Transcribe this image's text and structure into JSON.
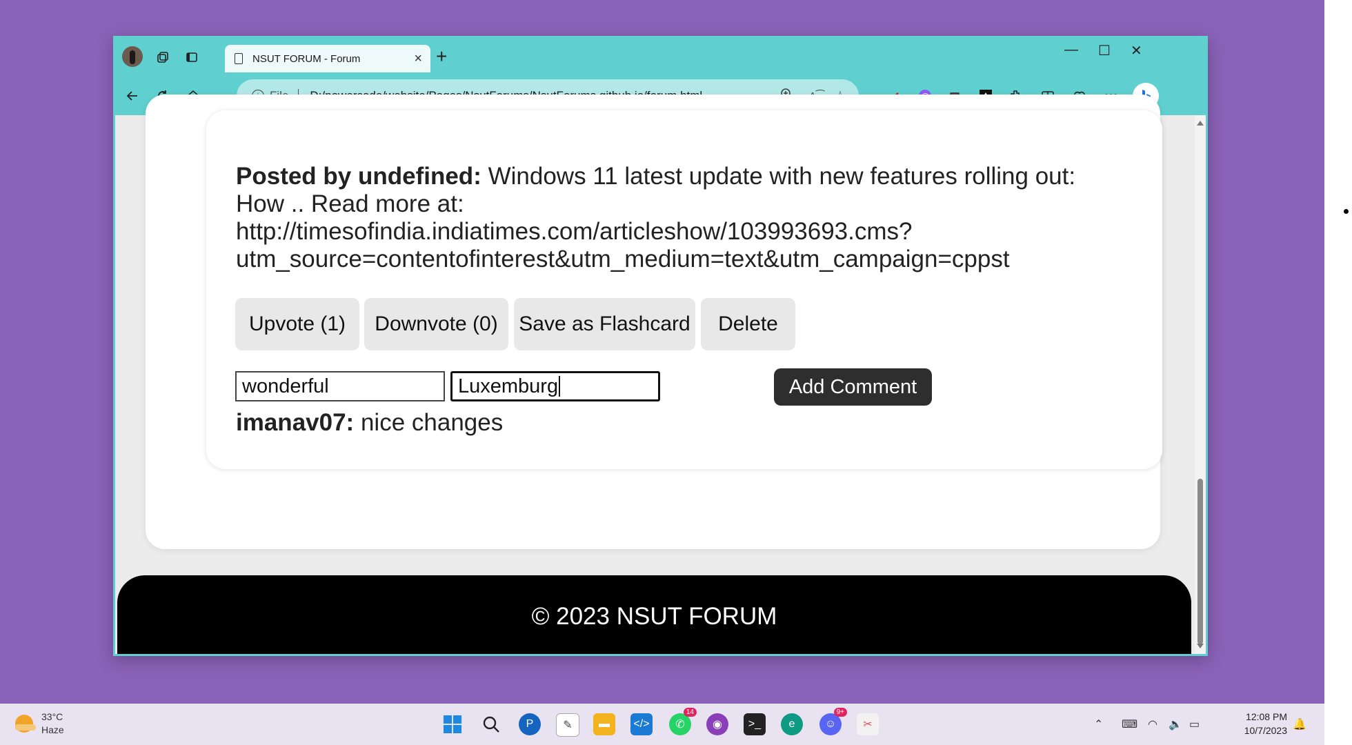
{
  "browser": {
    "tab_title": "NSUT FORUM - Forum",
    "new_tab_symbol": "+",
    "address_label": "File",
    "url": "D:/powercode/website/Pages/NsutForums/NsutForums.github.io/forum.html",
    "window_controls": {
      "minimize": "—",
      "maximize": "☐",
      "close": "✕"
    }
  },
  "post": {
    "author_prefix": "Posted by undefined:",
    "content": "Windows 11 latest update with new features rolling out: How .. Read more at: http://timesofindia.indiatimes.com/articleshow/103993693.cms?utm_source=contentofinterest&utm_medium=text&utm_campaign=cppst",
    "upvote_label": "Upvote (1)",
    "downvote_label": "Downvote (0)",
    "flashcard_label": "Save as Flashcard",
    "delete_label": "Delete",
    "comment_input_1": "wonderful",
    "comment_input_2": "Luxemburg",
    "add_comment_label": "Add Comment",
    "comments": [
      {
        "author": "imanav07:",
        "text": "nice changes"
      }
    ]
  },
  "footer": {
    "text": "© 2023 NSUT FORUM"
  },
  "taskbar": {
    "weather_temp": "33°C",
    "weather_desc": "Haze",
    "whatsapp_badge": "14",
    "discord_badge": "9+",
    "time": "12:08 PM",
    "date": "10/7/2023"
  },
  "colors": {
    "desktop": "#8a62b8",
    "browser_accent": "#5fcfcf",
    "address_bg": "#b3e8e8",
    "footer_bg": "#000000",
    "add_button_bg": "#2e2e2e"
  },
  "icons": [
    "profile-avatar",
    "collections-icon",
    "tab-actions-icon",
    "doc-icon",
    "back-icon",
    "refresh-icon",
    "home-icon",
    "info-icon",
    "zoom-icon",
    "read-aloud-icon",
    "favorite-icon",
    "pen-extension-icon",
    "extension-icon",
    "extensions-icon",
    "split-screen-icon",
    "favorites-icon",
    "more-icon",
    "bing-icon"
  ]
}
